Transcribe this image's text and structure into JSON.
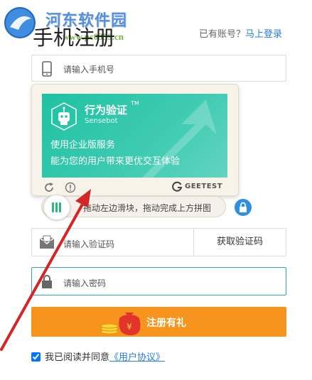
{
  "watermark": {
    "title": "河东软件园",
    "url": "www.pc0359.cn"
  },
  "header": {
    "title": "手机注册",
    "login_prompt": "已有账号？",
    "login_link": "马上登录"
  },
  "phone_field": {
    "placeholder": "请输入手机号",
    "icon": "phone-icon"
  },
  "captcha": {
    "brand": "行为验证",
    "trademark": "TM",
    "brand_sub": "Sensebot",
    "line1": "使用企业版服务",
    "line2": "能为您的用户带来更优交互体验",
    "vendor": "GEETEST",
    "banner_color": "#23c0a6"
  },
  "slider": {
    "hint": "拖动左边滑块，拖动完成上方拼图",
    "accent": "#2db87d"
  },
  "code_field": {
    "placeholder": "请输入验证码",
    "button": "获取验证码",
    "icon": "envelope-icon"
  },
  "password_field": {
    "placeholder": "请输入密码",
    "icon": "lock-icon"
  },
  "register": {
    "label": "注册有礼",
    "color": "#f7941d"
  },
  "agreement": {
    "text": "我已阅读并同意",
    "link": "《用户协议》",
    "checked": true
  }
}
